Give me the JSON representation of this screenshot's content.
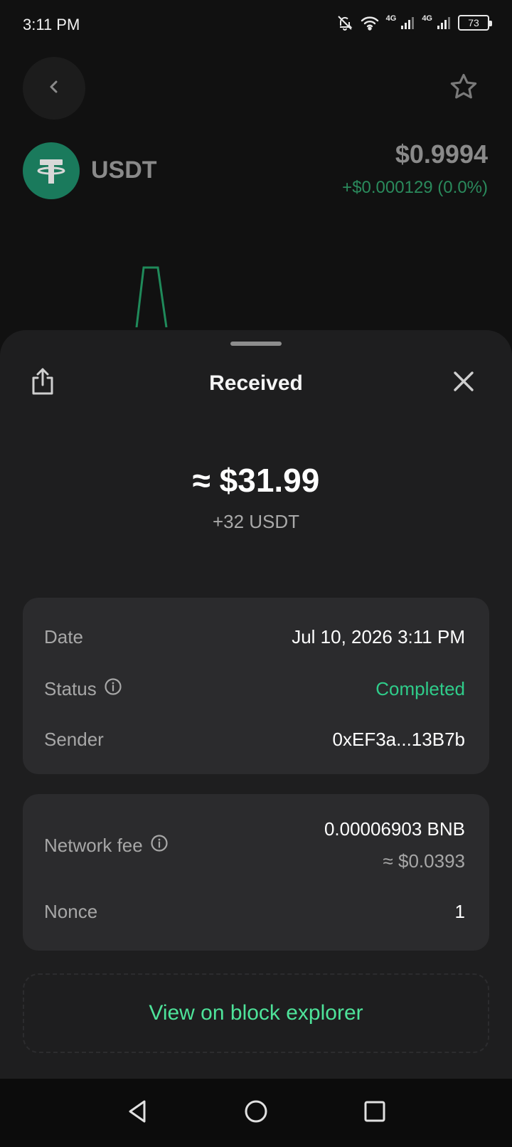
{
  "status_bar": {
    "time": "3:11 PM",
    "network_1": "4G",
    "network_2": "4G",
    "battery": "73",
    "icons": [
      "bell-off-icon",
      "wifi-icon",
      "signal-icon",
      "signal-icon",
      "battery-icon"
    ]
  },
  "header": {
    "token_symbol": "USDT",
    "price": "$0.9994",
    "change": "+$0.000129 (0.0%)",
    "icons": [
      "back-chevron-icon",
      "star-icon",
      "tether-logo"
    ]
  },
  "sheet": {
    "title": "Received",
    "amount_fiat": "≈ $31.99",
    "amount_token": "+32  USDT",
    "icons": [
      "share-icon",
      "close-icon"
    ],
    "details": {
      "date_label": "Date",
      "date_value": "Jul 10, 2026 3:11 PM",
      "status_label": "Status",
      "status_value": "Completed",
      "sender_label": "Sender",
      "sender_value": "0xEF3a...13B7b"
    },
    "fees": {
      "fee_label": "Network fee",
      "fee_bnb": "0.00006903 BNB",
      "fee_usd": "≈ $0.0393",
      "nonce_label": "Nonce",
      "nonce_value": "1"
    },
    "explorer_label": "View on block explorer"
  },
  "colors": {
    "accent_green": "#4ee39a",
    "status_green": "#2fcc8a",
    "tether_green": "#1a7a5c",
    "sheet_bg": "#1e1e1f",
    "card_bg": "#2b2b2d"
  },
  "nav_bar": {
    "icons": [
      "back-triangle-icon",
      "home-circle-icon",
      "recents-square-icon"
    ]
  }
}
